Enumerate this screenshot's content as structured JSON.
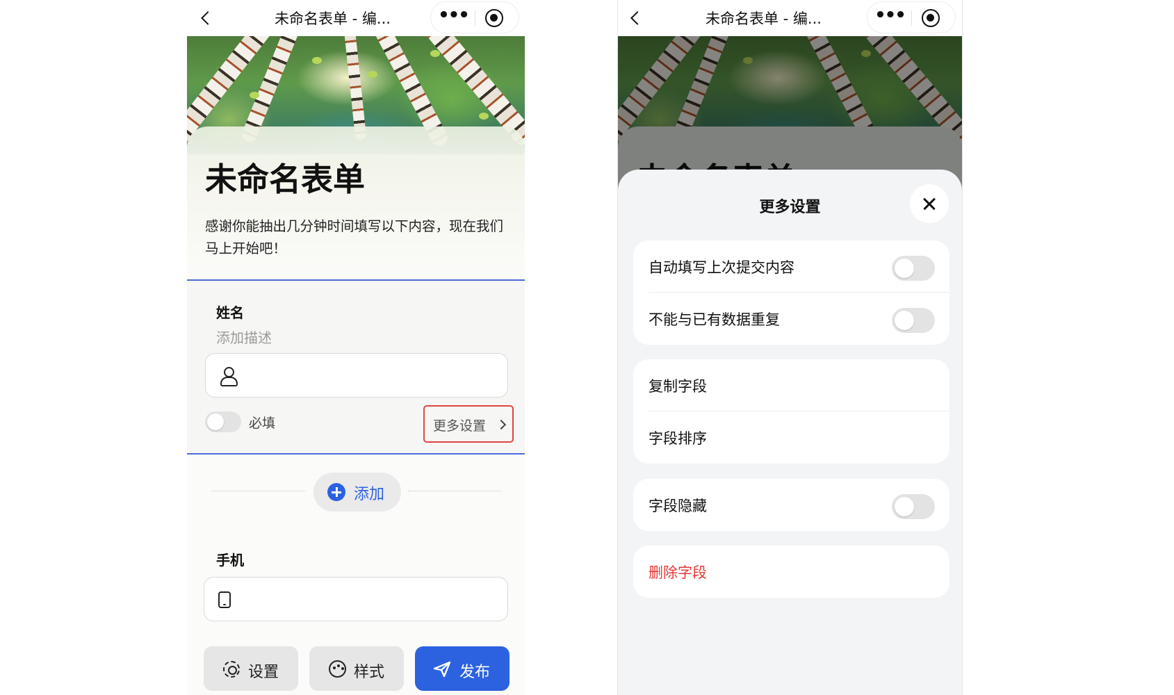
{
  "left_screen": {
    "nav": {
      "title": "未命名表单 - 编..."
    },
    "form": {
      "title": "未命名表单",
      "description": "感谢你能抽出几分钟时间填写以下内容，现在我们马上开始吧！"
    },
    "field_name": {
      "label": "姓名",
      "hint": "添加描述",
      "required_label": "必填",
      "more_settings_label": "更多设置"
    },
    "add_button": {
      "label": "添加"
    },
    "field_phone": {
      "label": "手机"
    },
    "bottom_bar": {
      "settings_label": "设置",
      "style_label": "样式",
      "publish_label": "发布"
    }
  },
  "right_screen": {
    "nav": {
      "title": "未命名表单 - 编..."
    },
    "sheet": {
      "title": "更多设置",
      "group1": [
        {
          "label": "自动填写上次提交内容",
          "toggle_on": false
        },
        {
          "label": "不能与已有数据重复",
          "toggle_on": false
        }
      ],
      "group2": [
        {
          "label": "复制字段"
        },
        {
          "label": "字段排序"
        }
      ],
      "group3": [
        {
          "label": "字段隐藏",
          "toggle_on": false
        }
      ],
      "delete_label": "删除字段"
    }
  },
  "colors": {
    "accent": "#2c62e0",
    "highlight_border": "#e0453f",
    "danger": "#e53935",
    "field_border": "#4d6bd7"
  }
}
